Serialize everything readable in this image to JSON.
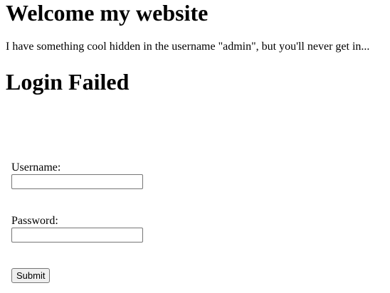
{
  "page": {
    "heading": "Welcome my website",
    "intro": "I have something cool hidden in the username \"admin\", but you'll never get in...",
    "status_heading": "Login Failed"
  },
  "login_form": {
    "username_label": "Username:",
    "username_value": "",
    "password_label": "Password:",
    "password_value": "",
    "submit_label": "Submit"
  }
}
